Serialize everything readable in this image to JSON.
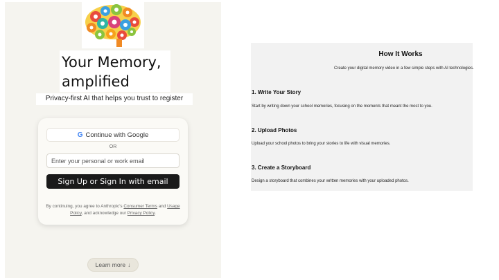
{
  "hero": {
    "logo_icon": "colorful-brain-gears-icon",
    "headline": "Your Memory, amplified",
    "subtitle": "Privacy-first AI that helps you trust to register"
  },
  "auth": {
    "google_label": "Continue with Google",
    "google_icon": "G",
    "or_label": "OR",
    "email_placeholder": "Enter your personal or work email",
    "email_value": "",
    "submit_label": "Sign Up or Sign In with email",
    "terms_prefix": "By continuing, you agree to Anthropic's ",
    "terms_link1": "Consumer Terms",
    "terms_and": " and ",
    "terms_link2": "Usage Policy",
    "terms_mid": ", and acknowledge our ",
    "terms_link3": "Privacy Policy",
    "terms_end": "."
  },
  "learn_more": {
    "label": "Learn more",
    "arrow": "↓"
  },
  "how_it_works": {
    "title": "How It Works",
    "subtitle": "Create your digital memory video in a few simple steps with AI technologies.",
    "steps": [
      {
        "title": "1. Write Your Story",
        "description": "Start by writing down your school memories, focusing on the moments that meant the most to you."
      },
      {
        "title": "2. Upload Photos",
        "description": "Upload your school photos to bring your stories to life with visual memories."
      },
      {
        "title": "3. Create a Storyboard",
        "description": "Design a storyboard that combines your written memories with your uploaded photos."
      }
    ]
  },
  "colors": {
    "page_bg": "#f5f4ef",
    "button_dark": "#1a1a1a",
    "google_blue": "#4285f4"
  }
}
